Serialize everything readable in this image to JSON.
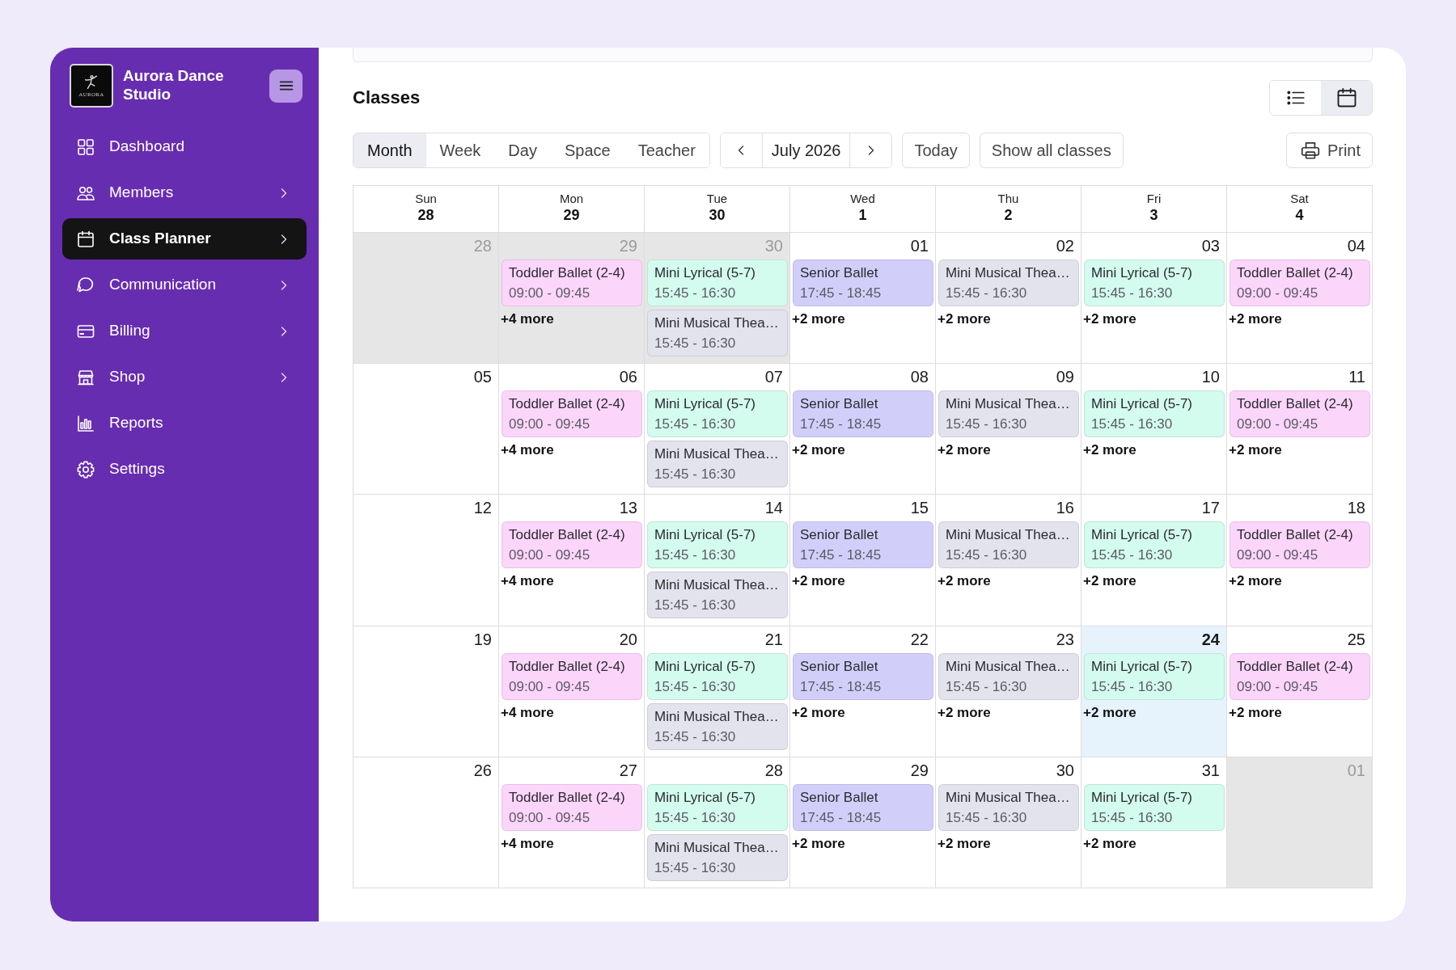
{
  "sidebar": {
    "logo": {
      "text": "AURORA"
    },
    "brand": "Aurora Dance Studio",
    "items": [
      {
        "label": "Dashboard",
        "selected": false,
        "expandable": false
      },
      {
        "label": "Members",
        "selected": false,
        "expandable": true
      },
      {
        "label": "Class Planner",
        "selected": true,
        "expandable": true
      },
      {
        "label": "Communication",
        "selected": false,
        "expandable": true
      },
      {
        "label": "Billing",
        "selected": false,
        "expandable": true
      },
      {
        "label": "Shop",
        "selected": false,
        "expandable": true
      },
      {
        "label": "Reports",
        "selected": false,
        "expandable": false
      },
      {
        "label": "Settings",
        "selected": false,
        "expandable": false
      }
    ]
  },
  "header": {
    "title": "Classes",
    "view_toggle": [
      {
        "selected": false
      },
      {
        "selected": true
      }
    ]
  },
  "toolbar": {
    "view_tabs": [
      {
        "label": "Month",
        "selected": true
      },
      {
        "label": "Week",
        "selected": false
      },
      {
        "label": "Day",
        "selected": false
      },
      {
        "label": "Space",
        "selected": false
      },
      {
        "label": "Teacher",
        "selected": false
      }
    ],
    "period": "July 2026",
    "buttons": [
      "Today",
      "Show all classes"
    ],
    "print": "Print"
  },
  "calendar": {
    "columns": [
      {
        "day": "Sun",
        "date": "28"
      },
      {
        "day": "Mon",
        "date": "29"
      },
      {
        "day": "Tue",
        "date": "30"
      },
      {
        "day": "Wed",
        "date": "1"
      },
      {
        "day": "Thu",
        "date": "2"
      },
      {
        "day": "Fri",
        "date": "3"
      },
      {
        "day": "Sat",
        "date": "4"
      }
    ],
    "weeks": [
      [
        {
          "date": "28",
          "outside_month": true,
          "today": false
        },
        {
          "date": "29",
          "outside_month": true,
          "today": false,
          "events": [
            {
              "name": "Toddler Ballet (2-4)",
              "time": "09:00 - 09:45",
              "color": "#fcd5fb"
            }
          ],
          "more": "+4 more"
        },
        {
          "date": "30",
          "outside_month": true,
          "today": false,
          "events": [
            {
              "name": "Mini Lyrical (5-7)",
              "time": "15:45 - 16:30",
              "color": "#d3fbee"
            },
            {
              "name": "Mini Musical Thea…",
              "time": "15:45 - 16:30",
              "color": "#e3e3ee"
            }
          ]
        },
        {
          "date": "01",
          "outside_month": false,
          "today": false,
          "events": [
            {
              "name": "Senior Ballet",
              "time": "17:45 - 18:45",
              "color": "#d1cffa"
            }
          ],
          "more": "+2 more"
        },
        {
          "date": "02",
          "outside_month": false,
          "today": false,
          "events": [
            {
              "name": "Mini Musical Thea…",
              "time": "15:45 - 16:30",
              "color": "#e3e3ee"
            }
          ],
          "more": "+2 more"
        },
        {
          "date": "03",
          "outside_month": false,
          "today": false,
          "events": [
            {
              "name": "Mini Lyrical (5-7)",
              "time": "15:45 - 16:30",
              "color": "#d3fbee"
            }
          ],
          "more": "+2 more"
        },
        {
          "date": "04",
          "outside_month": false,
          "today": false,
          "events": [
            {
              "name": "Toddler Ballet (2-4)",
              "time": "09:00 - 09:45",
              "color": "#fcd5fb"
            }
          ],
          "more": "+2 more"
        }
      ],
      [
        {
          "date": "05",
          "outside_month": false,
          "today": false
        },
        {
          "date": "06",
          "outside_month": false,
          "today": false,
          "events": [
            {
              "name": "Toddler Ballet (2-4)",
              "time": "09:00 - 09:45",
              "color": "#fcd5fb"
            }
          ],
          "more": "+4 more"
        },
        {
          "date": "07",
          "outside_month": false,
          "today": false,
          "events": [
            {
              "name": "Mini Lyrical (5-7)",
              "time": "15:45 - 16:30",
              "color": "#d3fbee"
            },
            {
              "name": "Mini Musical Thea…",
              "time": "15:45 - 16:30",
              "color": "#e3e3ee"
            }
          ]
        },
        {
          "date": "08",
          "outside_month": false,
          "today": false,
          "events": [
            {
              "name": "Senior Ballet",
              "time": "17:45 - 18:45",
              "color": "#d1cffa"
            }
          ],
          "more": "+2 more"
        },
        {
          "date": "09",
          "outside_month": false,
          "today": false,
          "events": [
            {
              "name": "Mini Musical Thea…",
              "time": "15:45 - 16:30",
              "color": "#e3e3ee"
            }
          ],
          "more": "+2 more"
        },
        {
          "date": "10",
          "outside_month": false,
          "today": false,
          "events": [
            {
              "name": "Mini Lyrical (5-7)",
              "time": "15:45 - 16:30",
              "color": "#d3fbee"
            }
          ],
          "more": "+2 more"
        },
        {
          "date": "11",
          "outside_month": false,
          "today": false,
          "events": [
            {
              "name": "Toddler Ballet (2-4)",
              "time": "09:00 - 09:45",
              "color": "#fcd5fb"
            }
          ],
          "more": "+2 more"
        }
      ],
      [
        {
          "date": "12",
          "outside_month": false,
          "today": false
        },
        {
          "date": "13",
          "outside_month": false,
          "today": false,
          "events": [
            {
              "name": "Toddler Ballet (2-4)",
              "time": "09:00 - 09:45",
              "color": "#fcd5fb"
            }
          ],
          "more": "+4 more"
        },
        {
          "date": "14",
          "outside_month": false,
          "today": false,
          "events": [
            {
              "name": "Mini Lyrical (5-7)",
              "time": "15:45 - 16:30",
              "color": "#d3fbee"
            },
            {
              "name": "Mini Musical Thea…",
              "time": "15:45 - 16:30",
              "color": "#e3e3ee"
            }
          ]
        },
        {
          "date": "15",
          "outside_month": false,
          "today": false,
          "events": [
            {
              "name": "Senior Ballet",
              "time": "17:45 - 18:45",
              "color": "#d1cffa"
            }
          ],
          "more": "+2 more"
        },
        {
          "date": "16",
          "outside_month": false,
          "today": false,
          "events": [
            {
              "name": "Mini Musical Thea…",
              "time": "15:45 - 16:30",
              "color": "#e3e3ee"
            }
          ],
          "more": "+2 more"
        },
        {
          "date": "17",
          "outside_month": false,
          "today": false,
          "events": [
            {
              "name": "Mini Lyrical (5-7)",
              "time": "15:45 - 16:30",
              "color": "#d3fbee"
            }
          ],
          "more": "+2 more"
        },
        {
          "date": "18",
          "outside_month": false,
          "today": false,
          "events": [
            {
              "name": "Toddler Ballet (2-4)",
              "time": "09:00 - 09:45",
              "color": "#fcd5fb"
            }
          ],
          "more": "+2 more"
        }
      ],
      [
        {
          "date": "19",
          "outside_month": false,
          "today": false
        },
        {
          "date": "20",
          "outside_month": false,
          "today": false,
          "events": [
            {
              "name": "Toddler Ballet (2-4)",
              "time": "09:00 - 09:45",
              "color": "#fcd5fb"
            }
          ],
          "more": "+4 more"
        },
        {
          "date": "21",
          "outside_month": false,
          "today": false,
          "events": [
            {
              "name": "Mini Lyrical (5-7)",
              "time": "15:45 - 16:30",
              "color": "#d3fbee"
            },
            {
              "name": "Mini Musical Thea…",
              "time": "15:45 - 16:30",
              "color": "#e3e3ee"
            }
          ]
        },
        {
          "date": "22",
          "outside_month": false,
          "today": false,
          "events": [
            {
              "name": "Senior Ballet",
              "time": "17:45 - 18:45",
              "color": "#d1cffa"
            }
          ],
          "more": "+2 more"
        },
        {
          "date": "23",
          "outside_month": false,
          "today": false,
          "events": [
            {
              "name": "Mini Musical Thea…",
              "time": "15:45 - 16:30",
              "color": "#e3e3ee"
            }
          ],
          "more": "+2 more"
        },
        {
          "date": "24",
          "outside_month": false,
          "today": true,
          "events": [
            {
              "name": "Mini Lyrical (5-7)",
              "time": "15:45 - 16:30",
              "color": "#d3fbee"
            }
          ],
          "more": "+2 more"
        },
        {
          "date": "25",
          "outside_month": false,
          "today": false,
          "events": [
            {
              "name": "Toddler Ballet (2-4)",
              "time": "09:00 - 09:45",
              "color": "#fcd5fb"
            }
          ],
          "more": "+2 more"
        }
      ],
      [
        {
          "date": "26",
          "outside_month": false,
          "today": false
        },
        {
          "date": "27",
          "outside_month": false,
          "today": false,
          "events": [
            {
              "name": "Toddler Ballet (2-4)",
              "time": "09:00 - 09:45",
              "color": "#fcd5fb"
            }
          ],
          "more": "+4 more"
        },
        {
          "date": "28",
          "outside_month": false,
          "today": false,
          "events": [
            {
              "name": "Mini Lyrical (5-7)",
              "time": "15:45 - 16:30",
              "color": "#d3fbee"
            },
            {
              "name": "Mini Musical Thea…",
              "time": "15:45 - 16:30",
              "color": "#e3e3ee"
            }
          ]
        },
        {
          "date": "29",
          "outside_month": false,
          "today": false,
          "events": [
            {
              "name": "Senior Ballet",
              "time": "17:45 - 18:45",
              "color": "#d1cffa"
            }
          ],
          "more": "+2 more"
        },
        {
          "date": "30",
          "outside_month": false,
          "today": false,
          "events": [
            {
              "name": "Mini Musical Thea…",
              "time": "15:45 - 16:30",
              "color": "#e3e3ee"
            }
          ],
          "more": "+2 more"
        },
        {
          "date": "31",
          "outside_month": false,
          "today": false,
          "events": [
            {
              "name": "Mini Lyrical (5-7)",
              "time": "15:45 - 16:30",
              "color": "#d3fbee"
            }
          ],
          "more": "+2 more"
        },
        {
          "date": "01",
          "outside_month": true,
          "today": false
        }
      ]
    ]
  }
}
